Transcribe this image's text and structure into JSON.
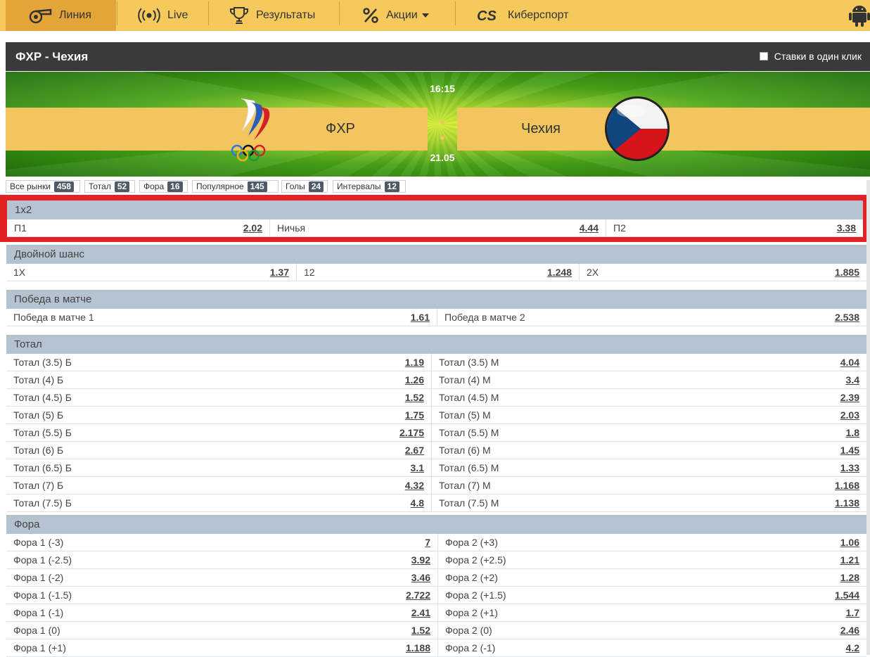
{
  "nav": {
    "items": [
      {
        "label": "Линия",
        "icon": "whistle-icon",
        "active": true
      },
      {
        "label": "Live",
        "icon": "live-broadcast-icon"
      },
      {
        "label": "Результаты",
        "icon": "trophy-icon"
      },
      {
        "label": "Акции",
        "icon": "percent-icon"
      },
      {
        "label": "Киберспорт",
        "icon": "cs-logo-icon"
      }
    ],
    "android_icon": "android-icon"
  },
  "header": {
    "title": "ФХР - Чехия",
    "one_click_label": "Ставки в один клик"
  },
  "match": {
    "home": "ФХР",
    "away": "Чехия",
    "time": "16:15",
    "date": "21.05"
  },
  "tabs": [
    {
      "label": "Все рынки",
      "count": "458"
    },
    {
      "label": "Тотал",
      "count": "52"
    },
    {
      "label": "Фора",
      "count": "16"
    },
    {
      "label": "Популярное",
      "count": "145"
    },
    {
      "label": "Голы",
      "count": "24"
    },
    {
      "label": "Интервалы",
      "count": "12"
    }
  ],
  "markets": {
    "m1x2": {
      "title": "1x2",
      "row": [
        {
          "label": "П1",
          "odd": "2.02"
        },
        {
          "label": "Ничья",
          "odd": "4.44"
        },
        {
          "label": "П2",
          "odd": "3.38"
        }
      ]
    },
    "double": {
      "title": "Двойной шанс",
      "row": [
        {
          "label": "1X",
          "odd": "1.37"
        },
        {
          "label": "12",
          "odd": "1.248"
        },
        {
          "label": "2X",
          "odd": "1.885"
        }
      ]
    },
    "win": {
      "title": "Победа в матче",
      "row": [
        {
          "label": "Победа в матче 1",
          "odd": "1.61"
        },
        {
          "label": "Победа в матче 2",
          "odd": "2.538"
        }
      ]
    },
    "total": {
      "title": "Тотал",
      "rows": [
        [
          {
            "label": "Тотал (3.5) Б",
            "odd": "1.19"
          },
          {
            "label": "Тотал (3.5) М",
            "odd": "4.04"
          }
        ],
        [
          {
            "label": "Тотал (4) Б",
            "odd": "1.26"
          },
          {
            "label": "Тотал (4) М",
            "odd": "3.4"
          }
        ],
        [
          {
            "label": "Тотал (4.5) Б",
            "odd": "1.52"
          },
          {
            "label": "Тотал (4.5) М",
            "odd": "2.39"
          }
        ],
        [
          {
            "label": "Тотал (5) Б",
            "odd": "1.75"
          },
          {
            "label": "Тотал (5) М",
            "odd": "2.03"
          }
        ],
        [
          {
            "label": "Тотал (5.5) Б",
            "odd": "2.175"
          },
          {
            "label": "Тотал (5.5) М",
            "odd": "1.8"
          }
        ],
        [
          {
            "label": "Тотал (6) Б",
            "odd": "2.67"
          },
          {
            "label": "Тотал (6) М",
            "odd": "1.45"
          }
        ],
        [
          {
            "label": "Тотал (6.5) Б",
            "odd": "3.1"
          },
          {
            "label": "Тотал (6.5) М",
            "odd": "1.33"
          }
        ],
        [
          {
            "label": "Тотал (7) Б",
            "odd": "4.32"
          },
          {
            "label": "Тотал (7) М",
            "odd": "1.168"
          }
        ],
        [
          {
            "label": "Тотал (7.5) Б",
            "odd": "4.8"
          },
          {
            "label": "Тотал (7.5) М",
            "odd": "1.138"
          }
        ]
      ]
    },
    "fora": {
      "title": "Фора",
      "rows": [
        [
          {
            "label": "Фора 1 (-3)",
            "odd": "7"
          },
          {
            "label": "Фора 2 (+3)",
            "odd": "1.06"
          }
        ],
        [
          {
            "label": "Фора 1 (-2.5)",
            "odd": "3.92"
          },
          {
            "label": "Фора 2 (+2.5)",
            "odd": "1.21"
          }
        ],
        [
          {
            "label": "Фора 1 (-2)",
            "odd": "3.46"
          },
          {
            "label": "Фора 2 (+2)",
            "odd": "1.28"
          }
        ],
        [
          {
            "label": "Фора 1 (-1.5)",
            "odd": "2.722"
          },
          {
            "label": "Фора 2 (+1.5)",
            "odd": "1.544"
          }
        ],
        [
          {
            "label": "Фора 1 (-1)",
            "odd": "2.41"
          },
          {
            "label": "Фора 2 (+1)",
            "odd": "1.7"
          }
        ],
        [
          {
            "label": "Фора 1 (0)",
            "odd": "1.52"
          },
          {
            "label": "Фора 2 (0)",
            "odd": "2.46"
          }
        ],
        [
          {
            "label": "Фора 1 (+1)",
            "odd": "1.188"
          },
          {
            "label": "Фора 2 (-1)",
            "odd": "4.2"
          }
        ]
      ]
    }
  },
  "colors": {
    "nav_bg": "#f5c95c",
    "nav_active": "#e3a53a",
    "highlight": "#e32024",
    "market_header": "#b4c3cf"
  }
}
